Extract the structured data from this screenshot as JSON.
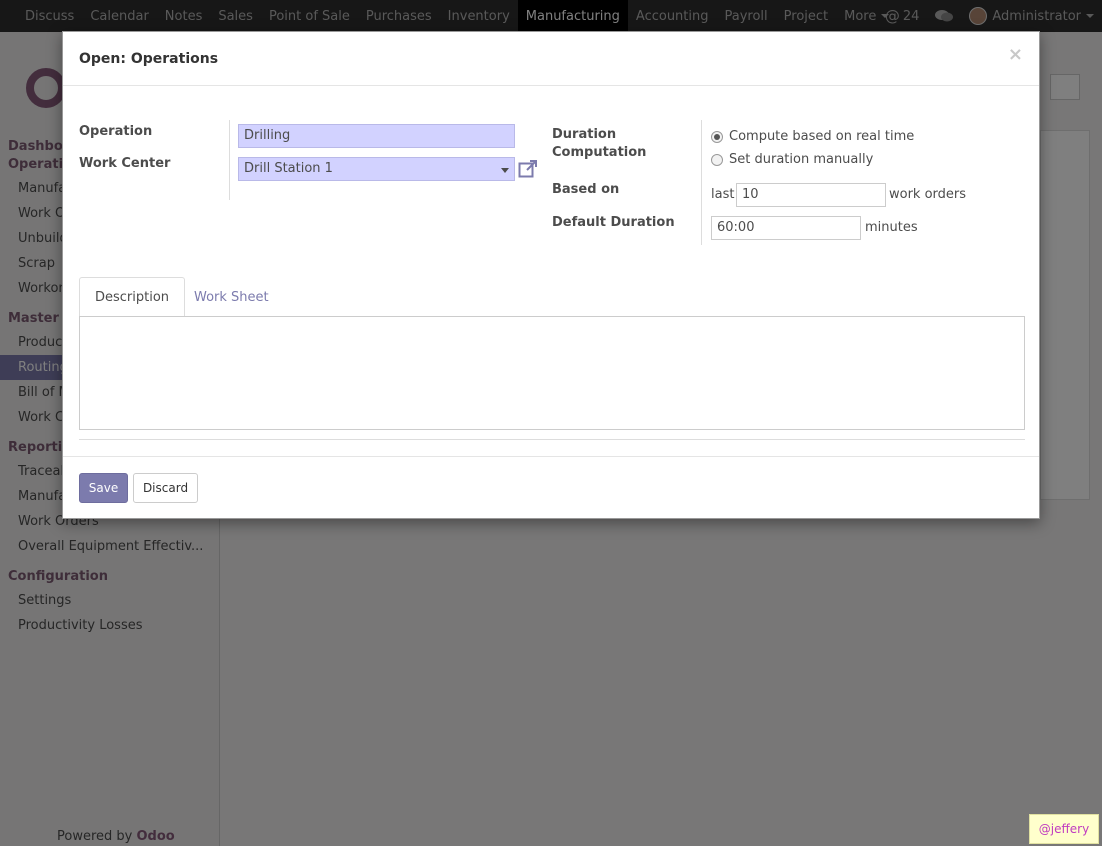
{
  "navbar": {
    "items": [
      "Discuss",
      "Calendar",
      "Notes",
      "Sales",
      "Point of Sale",
      "Purchases",
      "Inventory",
      "Manufacturing",
      "Accounting",
      "Payroll",
      "Project",
      "More"
    ],
    "active_index": 7,
    "mention_count": "24",
    "user_name": "Administrator"
  },
  "sidebar": {
    "sections": [
      {
        "label": "Dashboa",
        "items": []
      },
      {
        "label": "Operatio",
        "items": [
          "Manufac",
          "Work O",
          "Unbuild",
          "Scrap",
          "Workor"
        ]
      },
      {
        "label": "Master D",
        "items": [
          "Product",
          "Routing",
          "Bill of M",
          "Work C"
        ]
      },
      {
        "label": "Reporting",
        "items": [
          "Traceab",
          "Manufac",
          "Work Orders",
          "Overall Equipment Effectiv..."
        ]
      },
      {
        "label": "Configuration",
        "items": [
          "Settings",
          "Productivity Losses"
        ]
      }
    ],
    "active_item": "Routing",
    "powered_by": "Powered by",
    "brand": "Odoo"
  },
  "modal": {
    "title": "Open: Operations",
    "close_symbol": "×",
    "fields": {
      "operation_label": "Operation",
      "operation_value": "Drilling",
      "work_center_label": "Work Center",
      "work_center_value": "Drill Station 1",
      "duration_computation_label_1": "Duration",
      "duration_computation_label_2": "Computation",
      "radio_real_time": "Compute based on real time",
      "radio_manual": "Set duration manually",
      "based_on_label": "Based on",
      "based_on_prefix": "last",
      "based_on_value": "10",
      "based_on_suffix": "work orders",
      "default_duration_label": "Default Duration",
      "default_duration_value": "60:00",
      "default_duration_suffix": "minutes"
    },
    "selected_radio": "real_time",
    "tabs": [
      "Description",
      "Work Sheet"
    ],
    "active_tab": "Description",
    "buttons": {
      "save": "Save",
      "discard": "Discard"
    }
  },
  "watermark": "@jeffery",
  "colors": {
    "brand": "#875a7b",
    "primary": "#7c7bad",
    "required_field": "#d2d2ff",
    "navbar": "#2f2f2f"
  }
}
